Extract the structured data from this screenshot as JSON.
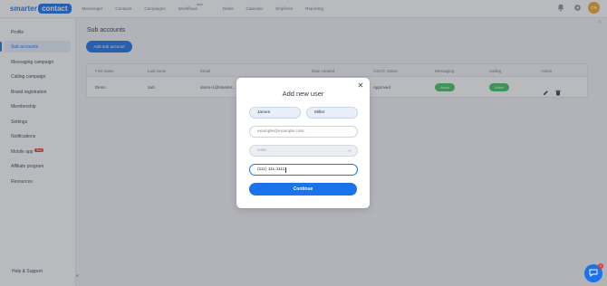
{
  "brand": {
    "word": "smarter",
    "boxed": "contact"
  },
  "topnav": {
    "items": [
      "Messenger",
      "Contacts",
      "Campaigns",
      "Workflows",
      "Deals",
      "Calendar",
      "Shipfinex",
      "Reporting"
    ],
    "workflows_tag": "NEW"
  },
  "user": {
    "initials": "CN"
  },
  "sidebar": {
    "items": [
      "Profile",
      "Sub accounts",
      "Messaging campaign",
      "Calling campaign",
      "Brand registration",
      "Membership",
      "Settings",
      "Notifications",
      "Mobile app",
      "Affiliate program",
      "Resources"
    ],
    "mobile_badge": "New",
    "help": "Help & Support",
    "collapse": "«"
  },
  "page": {
    "title": "Sub accounts",
    "add_button": "Add sub account",
    "close": "×"
  },
  "table": {
    "headers": [
      "First name",
      "Last name",
      "Email",
      "Date created",
      "CSC/C Status",
      "Messaging",
      "Calling",
      "Action"
    ],
    "rows": [
      {
        "first": "Demo",
        "last": "Sub",
        "email": "demo+1@smarter...",
        "status": "Approved",
        "messaging": "Active",
        "calling": "Active"
      }
    ]
  },
  "modal": {
    "title": "Add new user",
    "first_name": "James",
    "last_name": "Miller",
    "email_placeholder": "example@example.com",
    "role_placeholder": "User",
    "phone_value": "(111) 111-1111",
    "continue": "Continue"
  },
  "chat": {
    "badge": "1"
  },
  "colors": {
    "accent": "#1a73e8",
    "active_green": "#43c463",
    "badge_red": "#e53935"
  }
}
